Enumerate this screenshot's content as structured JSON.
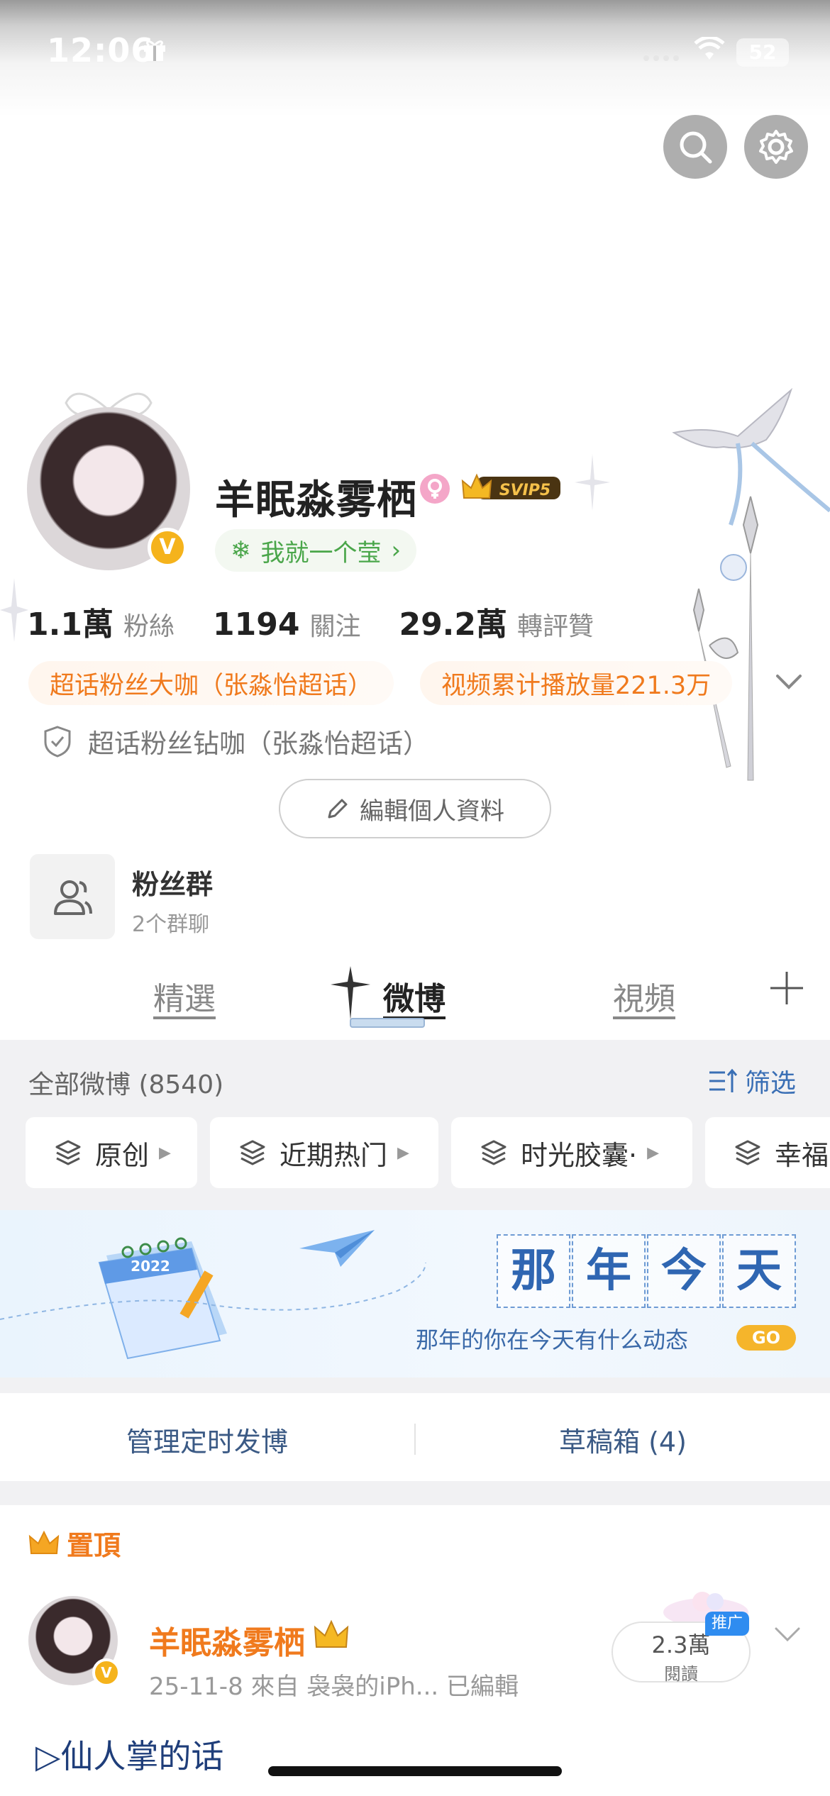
{
  "status": {
    "time": "12:06",
    "battery": "52"
  },
  "profile": {
    "name": "羊眠淼雾栖",
    "svip": "SVIP5",
    "signature": "我就一个莹",
    "verify_mark": "V",
    "stats": [
      {
        "value": "1.1萬",
        "label": "粉絲"
      },
      {
        "value": "1194",
        "label": "關注"
      },
      {
        "value": "29.2萬",
        "label": "轉評贊"
      }
    ],
    "chips": [
      "超话粉丝大咖（张淼怡超话）",
      "视频累计播放量221.3万"
    ],
    "badge": "超话粉丝钻咖（张淼怡超话）",
    "edit_label": "編輯個人資料"
  },
  "group": {
    "title": "粉丝群",
    "subtitle": "2个群聊"
  },
  "tabs": [
    "精選",
    "微博",
    "視頻"
  ],
  "feed": {
    "all_label": "全部微博 (8540)",
    "filter_label": "筛选",
    "filter_tabs": [
      "原创",
      "近期热门",
      "时光胶囊·",
      "幸福"
    ]
  },
  "banner": {
    "chars": [
      "那",
      "年",
      "今",
      "天"
    ],
    "subtitle": "那年的你在今天有什么动态",
    "go": "GO",
    "calendar_year": "2022"
  },
  "actions": {
    "scheduled": "管理定时发博",
    "drafts": "草稿箱 (4)"
  },
  "pinned": {
    "label": "置頂",
    "author": "羊眠淼雾栖",
    "meta": "25-11-8  來自 袅袅的iPh...  已編輯",
    "reads_value": "2.3萬",
    "reads_label": "閱讀",
    "promo": "推广",
    "text": "▷仙人掌的话"
  },
  "colors": {
    "accent": "#f07a1d",
    "link": "#3a6fb5",
    "verify": "#f5b31c"
  }
}
